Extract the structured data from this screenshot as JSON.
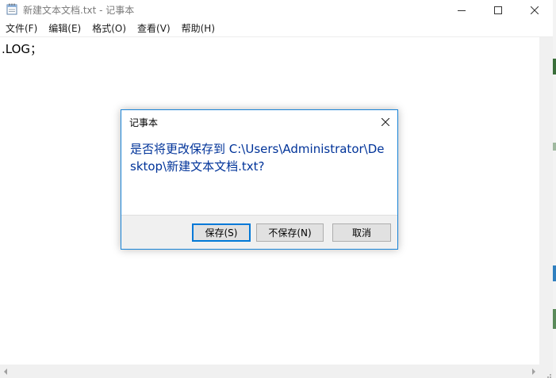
{
  "window": {
    "title": "新建文本文档.txt - 记事本",
    "app_icon": "notepad-icon",
    "controls": {
      "minimize_icon": "minimize-icon",
      "maximize_icon": "maximize-icon",
      "close_icon": "close-icon"
    }
  },
  "menu": {
    "items": [
      {
        "label": "文件(F)"
      },
      {
        "label": "编辑(E)"
      },
      {
        "label": "格式(O)"
      },
      {
        "label": "查看(V)"
      },
      {
        "label": "帮助(H)"
      }
    ]
  },
  "editor": {
    "content": ".LOG；"
  },
  "dialog": {
    "title": "记事本",
    "message": "是否将更改保存到 C:\\Users\\Administrator\\Desktop\\新建文本文档.txt?",
    "buttons": {
      "save": "保存(S)",
      "dont_save": "不保存(N)",
      "cancel": "取消"
    },
    "close_icon": "close-icon"
  },
  "colors": {
    "dialog_border": "#1883d7",
    "message_text": "#003399",
    "primary_button_border": "#0078d7",
    "footer_background": "#f0f0f0"
  }
}
